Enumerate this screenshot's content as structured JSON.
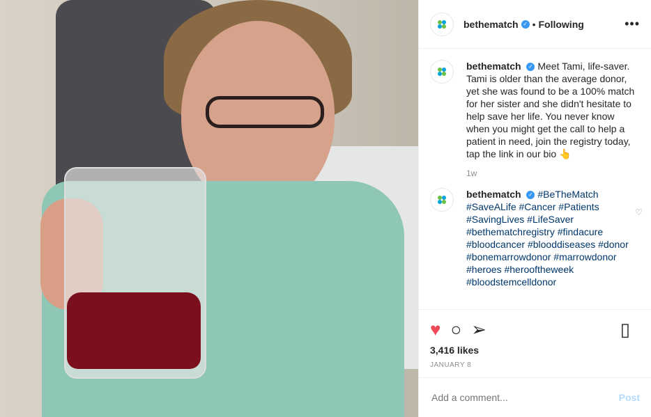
{
  "post": {
    "username": "bethematch",
    "following": "Following",
    "avatar_text": "BE THE MATCH",
    "caption": {
      "username": "bethematch",
      "text": "Meet Tami, life-saver. Tami is older than the average donor, yet she was found to be a 100% match for her sister and she didn't hesitate to help save her life. You never know when you might get the call to help a patient in need, join the registry today, tap the link in our bio 👆",
      "time": "1w"
    },
    "comment": {
      "username": "bethematch",
      "hashtags": "#BeTheMatch #SaveALife #Cancer #Patients #SavingLives #LifeSaver #bethematchregistry #findacure #bloodcancer #blooddiseases #donor #bonemarrowdonor #marrowdonor #heroes #herooftheweek #bloodstemcelldonor"
    },
    "likes": "3,416 likes",
    "date": "JANUARY 8",
    "add_comment_placeholder": "Add a comment...",
    "post_label": "Post"
  },
  "colors": {
    "link": "#00376b",
    "accent": "#3897f0",
    "heart": "#ed4956"
  },
  "icons": [
    "more-options-icon",
    "verified-badge-icon",
    "heart-icon",
    "comment-icon",
    "share-icon",
    "bookmark-icon",
    "small-heart-icon"
  ]
}
